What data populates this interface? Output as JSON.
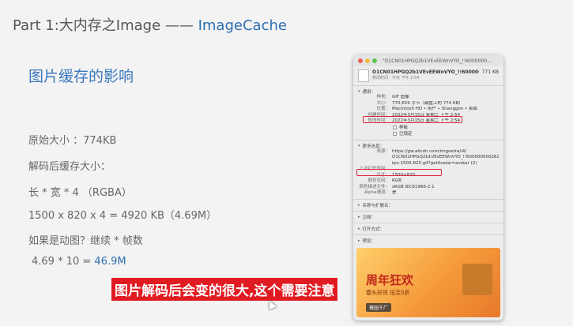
{
  "slide": {
    "title_prefix": "Part 1:大内存之Image —— ",
    "title_accent": "ImageCache",
    "heading": "图片缓存的影响",
    "lines": {
      "original_size": "原始大小 ：774KB",
      "decoded_label": "解码后缓存大小：",
      "formula": "长 * 宽 * 4 （RGBA）",
      "calc": "1500 x 820 x 4 = 4920 KB（4.69M）",
      "animated": "如果是动图？继续 * 帧数",
      "result_prefix": "4.69 * 10 = ",
      "result_value": "46.9M"
    }
  },
  "info_window": {
    "title": "\"O1CN01HPGQ2b1VEvEEWnVYO_!!6000000...",
    "file_name": "O1CN01HPGQ2b1VEvEEWnVYO_!!6000000...",
    "file_size": "771 KB",
    "modified": "修改时间：今天 下午 2:54",
    "general_label": "通用：",
    "general": [
      {
        "k": "种类：",
        "v": "GIF 图像"
      },
      {
        "k": "大小：",
        "v": "770,659 字节（磁盘上的 774 KB）"
      },
      {
        "k": "位置：",
        "v": "Macintosh HD • 用户 • Shanggon • 桌面"
      },
      {
        "k": "创建时间：",
        "v": "2022年3月15日 星期二 下午 2:54"
      },
      {
        "k": "修改时间：",
        "v": "2022年3月15日 星期二 下午 2:54"
      }
    ],
    "stationery": "样板",
    "locked": "已锁定",
    "more_info_label": "更多信息：",
    "more_info": [
      {
        "k": "来源：",
        "v": "https://gw.alicdn.com/imgextra/i4/"
      },
      {
        "k": "",
        "v": "O1CN01HPGQ2b1VEvEEWnVYO_!!6000000002622-1-"
      },
      {
        "k": "",
        "v": "tps-1500-820.gif?getAvatar=avatar (2)"
      },
      {
        "k": "上次打开时间：",
        "v": ""
      },
      {
        "k": "尺寸：",
        "v": "1500×820"
      },
      {
        "k": "颜色空间：",
        "v": "RGB"
      },
      {
        "k": "颜色描述文件：",
        "v": "sRGB IEC61966-2.1"
      },
      {
        "k": "Alpha通道：",
        "v": "是"
      }
    ],
    "sections": [
      "名称与扩展名：",
      "注释：",
      "打开方式：",
      "预览："
    ],
    "preview": {
      "headline": "周年狂欢",
      "sub": "春头好货 低至5折",
      "badge": "薇园千厂"
    }
  },
  "subtitle": "图片解码后会变的很大,这个需要注意",
  "colors": {
    "accent": "#2d6fb3",
    "subtitle_bg": "#e11b22",
    "highlight_box": "#e0263a"
  }
}
